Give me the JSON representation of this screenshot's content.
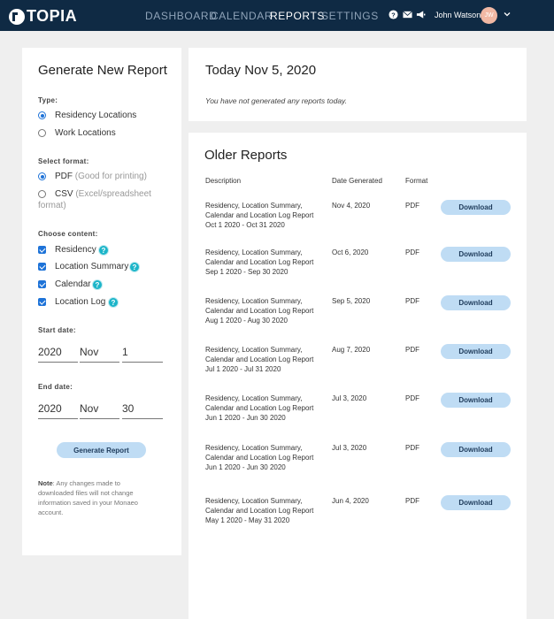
{
  "brand": "TOPIA",
  "nav": [
    "DASHBOARD",
    "CALENDAR",
    "REPORTS",
    "SETTINGS"
  ],
  "user": {
    "name": "John Watson",
    "initials": "JW"
  },
  "left": {
    "title": "Generate New Report",
    "type_label": "Type:",
    "type_options": [
      "Residency Locations",
      "Work Locations"
    ],
    "format_label": "Select format:",
    "format_pdf": "PDF",
    "format_pdf_sub": "(Good for printing)",
    "format_csv": "CSV",
    "format_csv_sub1": "(Excel/spreadsheet",
    "format_csv_sub2": "format)",
    "content_label": "Choose content:",
    "content_options": [
      "Residency",
      "Location Summary",
      "Calendar",
      "Location Log"
    ],
    "start_label": "Start date:",
    "start": {
      "year": "2020",
      "month": "Nov",
      "day": "1"
    },
    "end_label": "End date:",
    "end": {
      "year": "2020",
      "month": "Nov",
      "day": "30"
    },
    "generate_button": "Generate Report",
    "note_bold": "Note",
    "note_line1": ": Any changes made to",
    "note_line2": "downloaded files will not change",
    "note_line3": "information saved in your Monaeo",
    "note_line4": "account."
  },
  "today": {
    "title": "Today Nov 5, 2020",
    "message": "You have not generated any reports today."
  },
  "older": {
    "title": "Older Reports",
    "columns": [
      "Description",
      "Date Generated",
      "Format"
    ],
    "download_label": "Download",
    "rows": [
      {
        "d1": "Residency, Location Summary,",
        "d2": "Calendar and Location Log Report",
        "d3": "Oct 1 2020 - Oct 31 2020",
        "date": "Nov 4, 2020",
        "format": "PDF"
      },
      {
        "d1": "Residency, Location Summary,",
        "d2": "Calendar and Location Log Report",
        "d3": "Sep 1 2020 - Sep 30 2020",
        "date": "Oct 6, 2020",
        "format": "PDF"
      },
      {
        "d1": "Residency, Location Summary,",
        "d2": "Calendar and Location Log Report",
        "d3": "Aug 1 2020 - Aug 30 2020",
        "date": "Sep 5, 2020",
        "format": "PDF"
      },
      {
        "d1": "Residency, Location Summary,",
        "d2": "Calendar and Location Log Report",
        "d3": "Jul 1 2020 - Jul 31 2020",
        "date": "Aug 7, 2020",
        "format": "PDF"
      },
      {
        "d1": "Residency, Location Summary,",
        "d2": "Calendar and Location Log Report",
        "d3": "Jun 1 2020 - Jun 30 2020",
        "date": "Jul 3, 2020",
        "format": "PDF"
      },
      {
        "d1": "Residency, Location Summary,",
        "d2": "Calendar and Location Log Report",
        "d3": "Jun 1 2020 - Jun 30 2020",
        "date": "Jul 3, 2020",
        "format": "PDF"
      },
      {
        "d1": "Residency, Location Summary,",
        "d2": "Calendar and Location Log Report",
        "d3": "May 1 2020 - May 31 2020",
        "date": "Jun 4, 2020",
        "format": "PDF"
      }
    ]
  }
}
